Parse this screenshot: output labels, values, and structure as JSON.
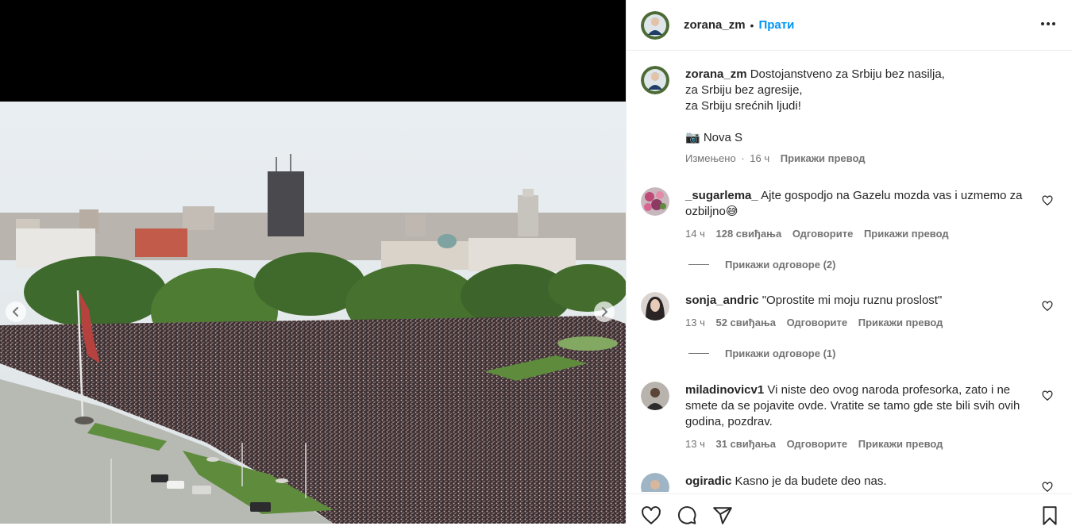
{
  "post": {
    "username": "zorana_zm",
    "separator": "•",
    "follow_label": "Прати",
    "more_icon": "more-horizontal-icon"
  },
  "caption": {
    "username": "zorana_zm",
    "text": "Dostojanstveno za Srbiju bez nasilja,\nza Srbiju bez agresije,\nza Srbiju srećnih ljudi!",
    "credit": "📷 Nova S",
    "edited": "Измењено",
    "sep": "·",
    "time": "16 ч",
    "translate": "Прикажи превод"
  },
  "comments": [
    {
      "username": "_sugarlema_",
      "text": "Ajte gospodjo na Gazelu mozda vas i uzmemo za ozbiljno😅",
      "time": "14 ч",
      "likes": "128 свиђања",
      "reply": "Одговорите",
      "translate": "Прикажи превод",
      "view_replies": "Прикажи одговоре (2)"
    },
    {
      "username": "sonja_andric",
      "text": "\"Oprostite mi moju ruznu proslost\"",
      "time": "13 ч",
      "likes": "52 свиђања",
      "reply": "Одговорите",
      "translate": "Прикажи превод",
      "view_replies": "Прикажи одговоре (1)"
    },
    {
      "username": "miladinovicv1",
      "text": "Vi niste deo ovog naroda profesorka, zato i ne smete da se pojavite ovde. Vratite se tamo gde ste bili svih ovih godina, pozdrav.",
      "time": "13 ч",
      "likes": "31 свиђања",
      "reply": "Одговорите",
      "translate": "Прикажи превод"
    },
    {
      "username": "ogiradic",
      "text": "Kasno je da budete deo nas."
    }
  ],
  "actions": {
    "like_icon": "heart-icon",
    "comment_icon": "comment-icon",
    "share_icon": "send-icon",
    "save_icon": "bookmark-icon"
  },
  "media": {
    "prev_icon": "chevron-left-icon",
    "next_icon": "chevron-right-icon"
  }
}
